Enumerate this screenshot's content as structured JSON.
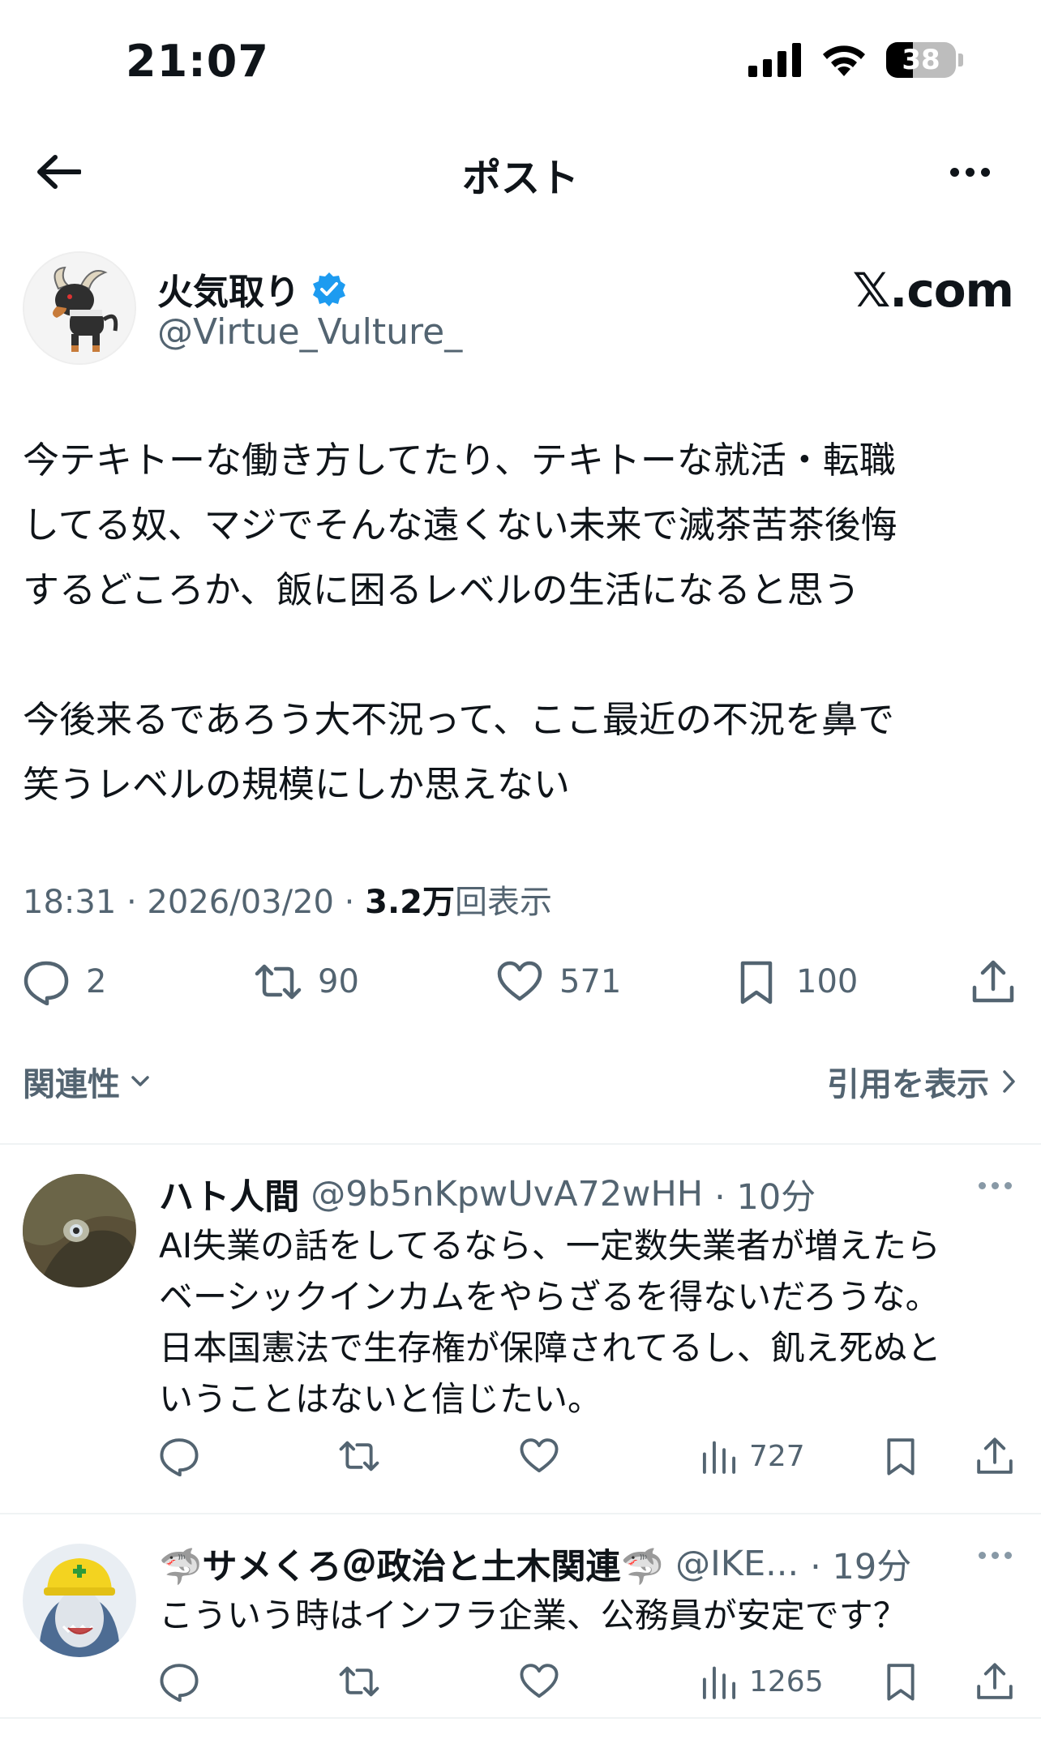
{
  "status_bar": {
    "time": "21:07",
    "battery": "38",
    "battery_level": 0.38
  },
  "nav": {
    "title": "ポスト"
  },
  "post": {
    "author_name": "火気取り",
    "author_handle": "@Virtue_Vulture_",
    "brand": "𝕏.com",
    "paragraphs": [
      [
        "今テキトーな働き方してたり、テキトーな就活・転職",
        "してる奴、マジでそんな遠くない未来で滅茶苦茶後悔",
        "するどころか、飯に困るレベルの生活になると思う"
      ],
      [
        "今後来るであろう大不況って、ここ最近の不況を鼻で",
        "笑うレベルの規模にしか思えない"
      ]
    ],
    "timestamp": "18:31 · 2026/03/20 · ",
    "views_value": "3.2万",
    "views_suffix": "回表示",
    "stats": {
      "replies": "2",
      "reposts": "90",
      "likes": "571",
      "bookmarks": "100"
    }
  },
  "filters": {
    "relevance": "関連性",
    "view_quotes": "引用を表示"
  },
  "replies": [
    {
      "name": "ハト人間",
      "handle": "@9b5nKpwUvA72wHH",
      "time": "· 10分",
      "lines": [
        "AI失業の話をしてるなら、一定数失業者が増えたら",
        "ベーシックインカムをやらざるを得ないだろうな。",
        "日本国憲法で生存権が保障されてるし、飢え死ぬと",
        "いうことはないと信じたい。"
      ],
      "views": "727"
    },
    {
      "name": "🦈サメくろ＠政治と土木関連🦈",
      "handle": "@IKE...",
      "time": "· 19分",
      "lines": [
        "こういう時はインフラ企業、公務員が安定です？"
      ],
      "views": "1265"
    }
  ],
  "colors": {
    "text": "#0f1419",
    "muted": "#536471",
    "verified": "#1d9bf0",
    "divider": "#eff3f4"
  }
}
